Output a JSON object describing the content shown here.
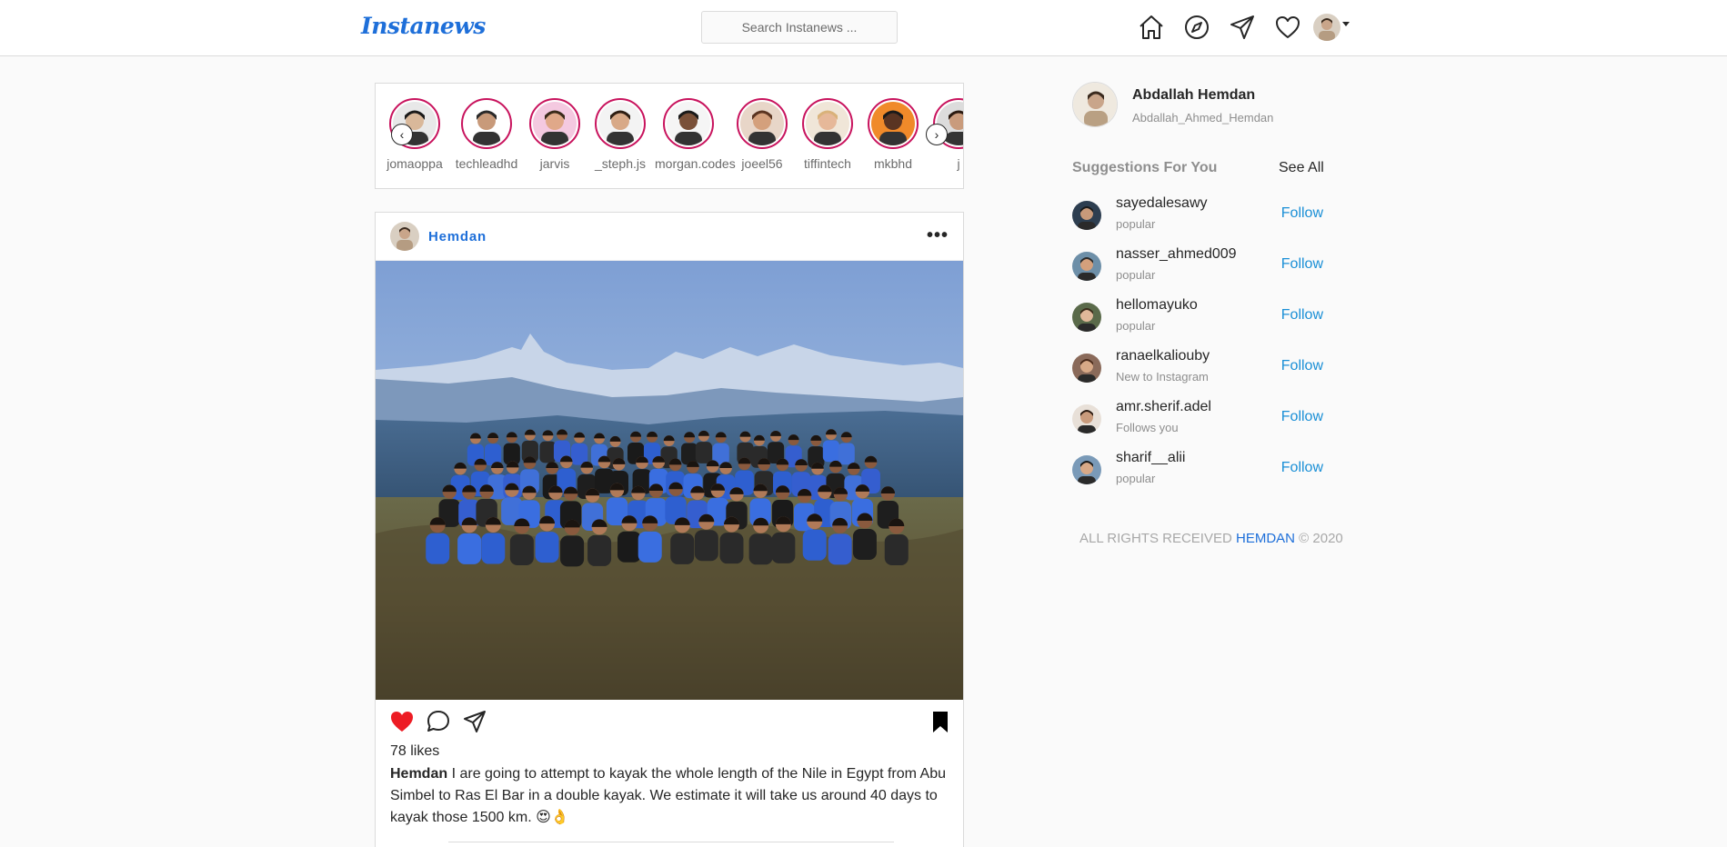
{
  "header": {
    "logo": "Instanews",
    "search_placeholder": "Search Instanews ..."
  },
  "stories": [
    {
      "name": "jomaoppa",
      "skin": "#d9b89a",
      "hair": "#1a1a1a",
      "bg": "#e8e8e8"
    },
    {
      "name": "techleadhd",
      "skin": "#c89a7a",
      "hair": "#2a2a2a",
      "bg": "#ffffff"
    },
    {
      "name": "jarvis",
      "skin": "#e0a889",
      "hair": "#3a2a1a",
      "bg": "#f4c9e0"
    },
    {
      "name": "_steph.js",
      "skin": "#d8a987",
      "hair": "#2e1e12",
      "bg": "#f3f3f3"
    },
    {
      "name": "morgan.codes",
      "skin": "#7a5038",
      "hair": "#1a1a1a",
      "bg": "#f5f5f5"
    },
    {
      "name": "joeel56",
      "skin": "#d4a07c",
      "hair": "#5a3420",
      "bg": "#e8d6c8"
    },
    {
      "name": "tiffintech",
      "skin": "#e6b899",
      "hair": "#d9b27a",
      "bg": "#f0e6d8"
    },
    {
      "name": "mkbhd",
      "skin": "#5a3422",
      "hair": "#1a1a1a",
      "bg": "#f08a2a"
    },
    {
      "name": "j",
      "skin": "#c99b7c",
      "hair": "#2a1a10",
      "bg": "#dcdcdc"
    }
  ],
  "post": {
    "username": "Hemdan",
    "likes": "78 likes",
    "caption_user": "Hemdan",
    "caption_text": " I are going to attempt to kayak the whole length of the Nile in Egypt from Abu Simbel to Ras El Bar in a double kayak. We estimate it will take us around 40 days to kayak those 1500 km. 😍👌"
  },
  "profile": {
    "name": "Abdallah Hemdan",
    "handle": "Abdallah_Ahmed_Hemdan"
  },
  "suggestions": {
    "title": "Suggestions For You",
    "see_all": "See All",
    "follow_label": "Follow",
    "items": [
      {
        "username": "sayedalesawy",
        "subtitle": "popular"
      },
      {
        "username": "nasser_ahmed009",
        "subtitle": "popular"
      },
      {
        "username": "hellomayuko",
        "subtitle": "popular"
      },
      {
        "username": "ranaelkaliouby",
        "subtitle": "New to Instagram"
      },
      {
        "username": "amr.sherif.adel",
        "subtitle": "Follows you"
      },
      {
        "username": "sharif__alii",
        "subtitle": "popular"
      }
    ]
  },
  "footer": {
    "prefix": "ALL RIGHTS RECEIVED ",
    "brand": "HEMDAN",
    "suffix": " © 2020"
  },
  "colors": {
    "accent": "#1e6fd9",
    "story_ring": "#c8135d",
    "like": "#ed1c24"
  }
}
